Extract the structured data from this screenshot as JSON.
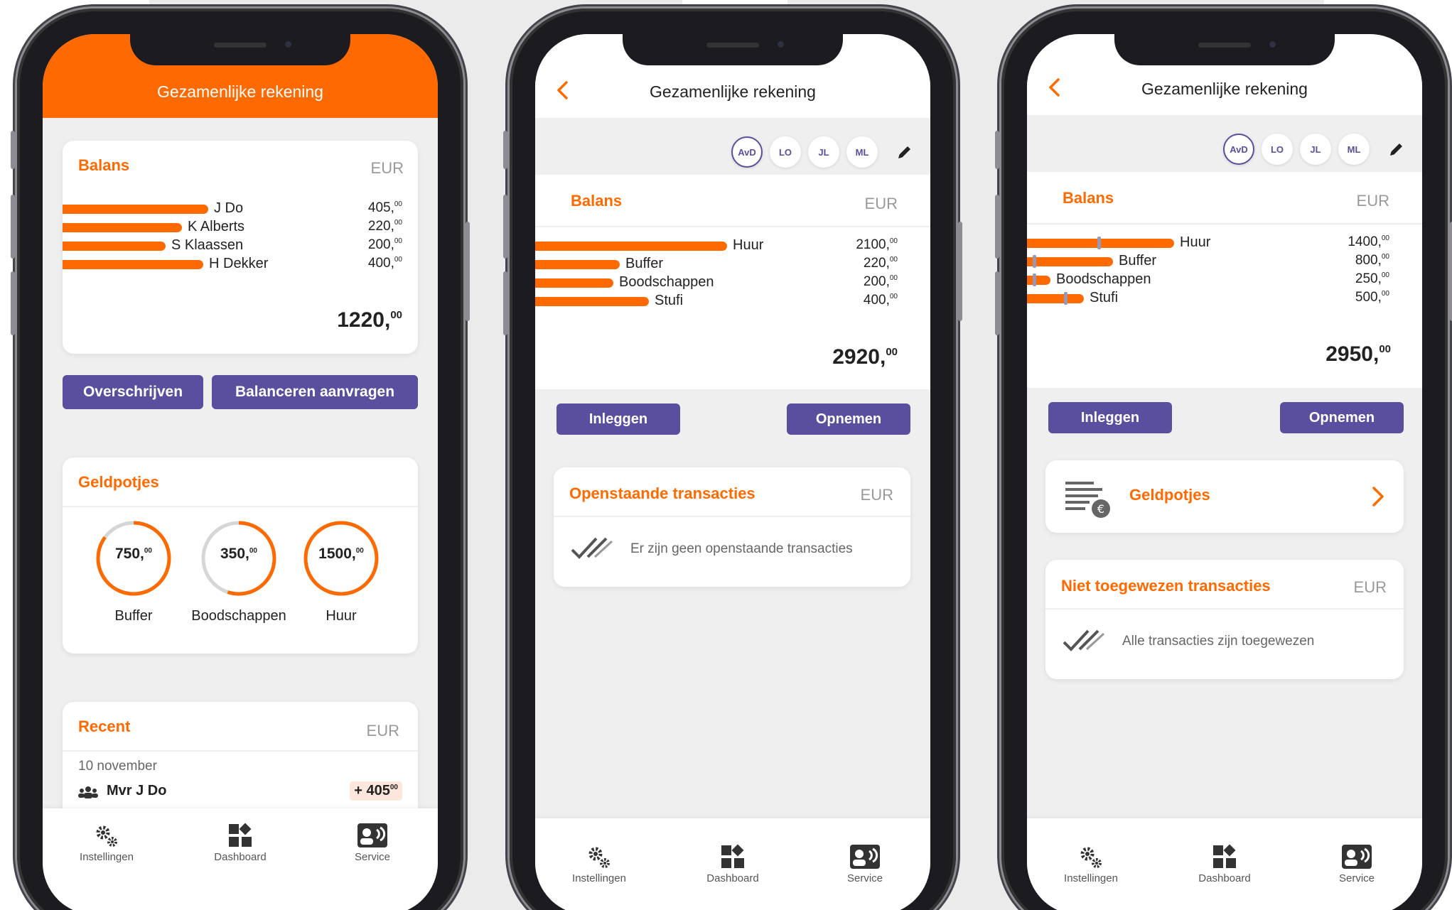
{
  "screen1": {
    "title": "Gezamenlijke rekening",
    "balance": {
      "title": "Balans",
      "currency": "EUR",
      "rows": [
        {
          "label": "J Do",
          "int": "405,",
          "dec": "00",
          "fraction": 0.62
        },
        {
          "label": "K Alberts",
          "int": "220,",
          "dec": "00",
          "fraction": 0.51
        },
        {
          "label": "S Klaassen",
          "int": "200,",
          "dec": "00",
          "fraction": 0.44
        },
        {
          "label": "H Dekker",
          "int": "400,",
          "dec": "00",
          "fraction": 0.6
        }
      ],
      "total_int": "1220,",
      "total_dec": "00"
    },
    "btn_transfer": "Overschrijven",
    "btn_balance": "Balanceren aanvragen",
    "pots": {
      "title": "Geldpotjes",
      "items": [
        {
          "value_int": "750,",
          "value_dec": "00",
          "label": "Buffer",
          "progress": 0.85
        },
        {
          "value_int": "350,",
          "value_dec": "00",
          "label": "Boodschappen",
          "progress": 0.55
        },
        {
          "value_int": "1500,",
          "value_dec": "00",
          "label": "Huur",
          "progress": 1.0
        }
      ]
    },
    "recent": {
      "title": "Recent",
      "currency": "EUR",
      "date": "10 november",
      "name": "Mvr J Do",
      "amount_int": "+ 405",
      "amount_dec": "00"
    }
  },
  "screen2": {
    "title": "Gezamenlijke rekening",
    "avatars": [
      "AvD",
      "LO",
      "JL",
      "ML"
    ],
    "balance": {
      "title": "Balans",
      "currency": "EUR",
      "rows": [
        {
          "label": "Huur",
          "int": "2100,",
          "dec": "00",
          "fraction": 0.98
        },
        {
          "label": "Buffer",
          "int": "220,",
          "dec": "00",
          "fraction": 0.43
        },
        {
          "label": "Boodschappen",
          "int": "200,",
          "dec": "00",
          "fraction": 0.4
        },
        {
          "label": "Stufi",
          "int": "400,",
          "dec": "00",
          "fraction": 0.58
        }
      ],
      "total_int": "2920,",
      "total_dec": "00"
    },
    "btn_deposit": "Inleggen",
    "btn_withdraw": "Opnemen",
    "open": {
      "title": "Openstaande transacties",
      "currency": "EUR",
      "empty": "Er zijn geen openstaande transacties"
    }
  },
  "screen3": {
    "title": "Gezamenlijke rekening",
    "avatars": [
      "AvD",
      "LO",
      "JL",
      "ML"
    ],
    "balance": {
      "title": "Balans",
      "currency": "EUR",
      "rows": [
        {
          "label": "Huur",
          "int": "1400,",
          "dec": "00",
          "fraction": 0.75,
          "marker": 0.36
        },
        {
          "label": "Buffer",
          "int": "800,",
          "dec": "00",
          "fraction": 0.44,
          "marker": 0.03
        },
        {
          "label": "Boodschappen",
          "int": "250,",
          "dec": "00",
          "fraction": 0.12,
          "marker": 0.03
        },
        {
          "label": "Stufi",
          "int": "500,",
          "dec": "00",
          "fraction": 0.29,
          "marker": 0.19
        }
      ],
      "total_int": "2950,",
      "total_dec": "00"
    },
    "btn_deposit": "Inleggen",
    "btn_withdraw": "Opnemen",
    "pots_link": "Geldpotjes",
    "unassigned": {
      "title": "Niet toegewezen transacties",
      "currency": "EUR",
      "empty": "Alle transacties zijn toegewezen"
    }
  },
  "tabs": {
    "settings": "Instellingen",
    "dashboard": "Dashboard",
    "service": "Service"
  },
  "colors": {
    "accent": "#ff6a00",
    "primary": "#5a4f9e"
  }
}
